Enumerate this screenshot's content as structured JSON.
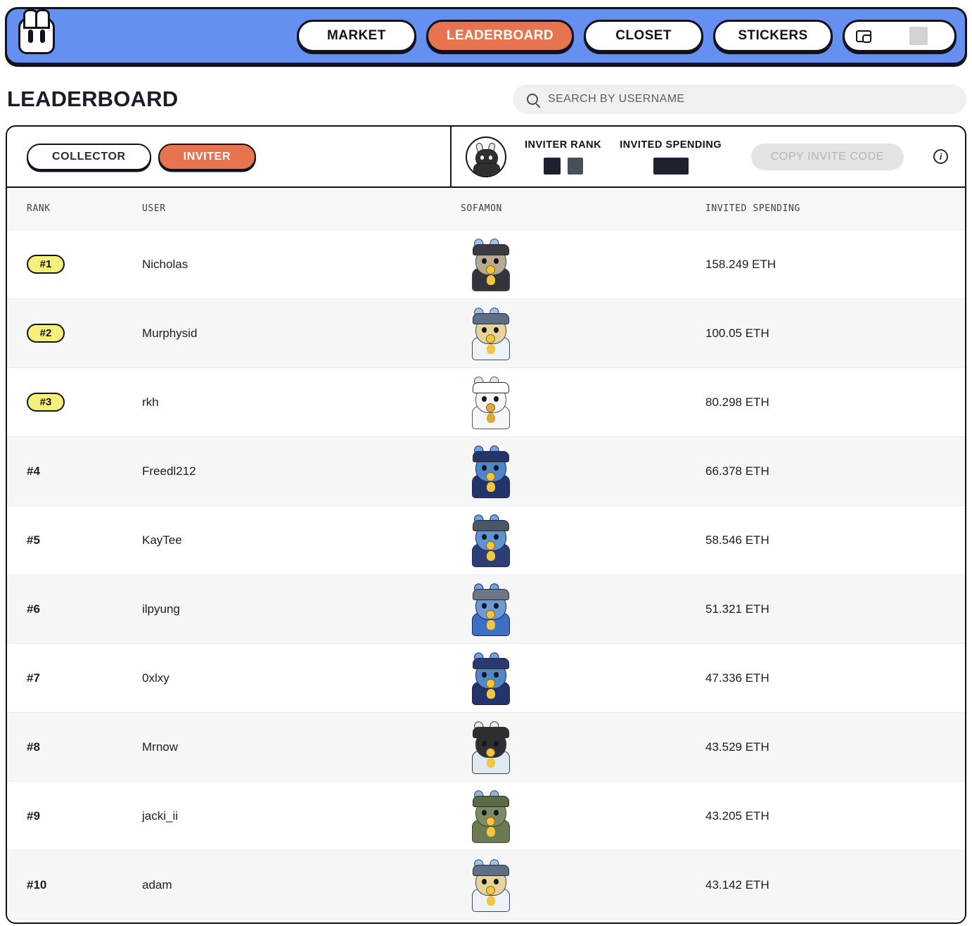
{
  "nav": {
    "logo_icon": "bunny-logo-icon",
    "items": [
      {
        "label": "MARKET",
        "active": false
      },
      {
        "label": "LEADERBOARD",
        "active": true
      },
      {
        "label": "CLOSET",
        "active": false
      },
      {
        "label": "STICKERS",
        "active": false
      }
    ],
    "wallet": {
      "icon": "wallet-icon",
      "value_redacted": true
    }
  },
  "header": {
    "title": "LEADERBOARD",
    "search": {
      "placeholder": "SEARCH BY USERNAME",
      "value": "",
      "icon": "search-icon"
    }
  },
  "filters": {
    "tabs": [
      {
        "label": "COLLECTOR",
        "active": false
      },
      {
        "label": "INVITER",
        "active": true
      }
    ]
  },
  "stats": {
    "avatar_icon": "user-sofamon-avatar",
    "inviter_rank": {
      "label": "INVITER RANK",
      "value_redacted": true
    },
    "invited_spending": {
      "label": "INVITED SPENDING",
      "value_redacted": true
    },
    "copy_invite_code_label": "COPY INVITE CODE",
    "copy_disabled": true,
    "info_icon": "info-icon"
  },
  "table": {
    "columns": [
      "RANK",
      "USER",
      "SOFAMON",
      "INVITED SPENDING"
    ],
    "rows": [
      {
        "rank": "#1",
        "user": "Nicholas",
        "sofamon": "sofamon-avatar-dark-hoodie",
        "spending": "158.249 ETH",
        "top3": true
      },
      {
        "rank": "#2",
        "user": "Murphysid",
        "sofamon": "sofamon-avatar-white-hoodie",
        "spending": "100.05 ETH",
        "top3": true
      },
      {
        "rank": "#3",
        "user": "rkh",
        "sofamon": "sofamon-avatar-white-bunny",
        "spending": "80.298 ETH",
        "top3": true
      },
      {
        "rank": "#4",
        "user": "Freedl212",
        "sofamon": "sofamon-avatar-blue-hoodie",
        "spending": "66.378 ETH",
        "top3": false
      },
      {
        "rank": "#5",
        "user": "KayTee",
        "sofamon": "sofamon-avatar-blue-cap",
        "spending": "58.546 ETH",
        "top3": false
      },
      {
        "rank": "#6",
        "user": "ilpyung",
        "sofamon": "sofamon-avatar-blue-jacket",
        "spending": "51.321 ETH",
        "top3": false
      },
      {
        "rank": "#7",
        "user": "0xlxy",
        "sofamon": "sofamon-avatar-navy-hoodie",
        "spending": "47.336 ETH",
        "top3": false
      },
      {
        "rank": "#8",
        "user": "Mrnow",
        "sofamon": "sofamon-avatar-bunny-white-tee",
        "spending": "43.529 ETH",
        "top3": false
      },
      {
        "rank": "#9",
        "user": "jacki_ii",
        "sofamon": "sofamon-avatar-camo-hoodie",
        "spending": "43.205 ETH",
        "top3": false
      },
      {
        "rank": "#10",
        "user": "adam",
        "sofamon": "sofamon-avatar-white-hoodie-2",
        "spending": "43.142 ETH",
        "top3": false
      }
    ]
  },
  "colors": {
    "nav_blue": "#6590f2",
    "accent_orange": "#e8734f",
    "rank_yellow": "#f4f07a",
    "ink": "#11131c",
    "row_alt": "#f6f6f6"
  },
  "avatar_palettes": [
    {
      "outline": "#3b4a66",
      "ear": "#9fc2e8",
      "head": "#b9a98d",
      "hat": "#3a3a40",
      "body": "#34343a",
      "accent": "#f2c640"
    },
    {
      "outline": "#3b4a66",
      "ear": "#9fc2e8",
      "head": "#e8d49a",
      "hat": "#5d6e86",
      "body": "#eef1f5",
      "accent": "#f2c640"
    },
    {
      "outline": "#55555a",
      "ear": "#f3e3e3",
      "head": "#f7f7f7",
      "hat": "#ffffff",
      "body": "#f7f7f7",
      "accent": "#e0a83c"
    },
    {
      "outline": "#1e2a55",
      "ear": "#6ea5e0",
      "head": "#4f86c9",
      "hat": "#25336b",
      "body": "#25336b",
      "accent": "#f2c640"
    },
    {
      "outline": "#1e2a55",
      "ear": "#6ea5e0",
      "head": "#5f94d2",
      "hat": "#4a5566",
      "body": "#2c3e78",
      "accent": "#f2c640"
    },
    {
      "outline": "#1e2a55",
      "ear": "#6ea5e0",
      "head": "#6b9ad6",
      "hat": "#6d7886",
      "body": "#3f6fc4",
      "accent": "#f2c640"
    },
    {
      "outline": "#1e2a55",
      "ear": "#6ea5e0",
      "head": "#5288c7",
      "hat": "#2a3a70",
      "body": "#25336b",
      "accent": "#f2c640"
    },
    {
      "outline": "#3a3a3f",
      "ear": "#e9e9ec",
      "head": "#2e2e33",
      "hat": "#2e2e33",
      "body": "#dfe9f2",
      "accent": "#f2c640"
    },
    {
      "outline": "#3f4a33",
      "ear": "#8fb6e0",
      "head": "#7e8a63",
      "hat": "#5c6a45",
      "body": "#6b7a52",
      "accent": "#f2c640"
    },
    {
      "outline": "#3b4a66",
      "ear": "#9fc2e8",
      "head": "#e8d49a",
      "hat": "#5d6e86",
      "body": "#eef1f5",
      "accent": "#f2c640"
    }
  ]
}
